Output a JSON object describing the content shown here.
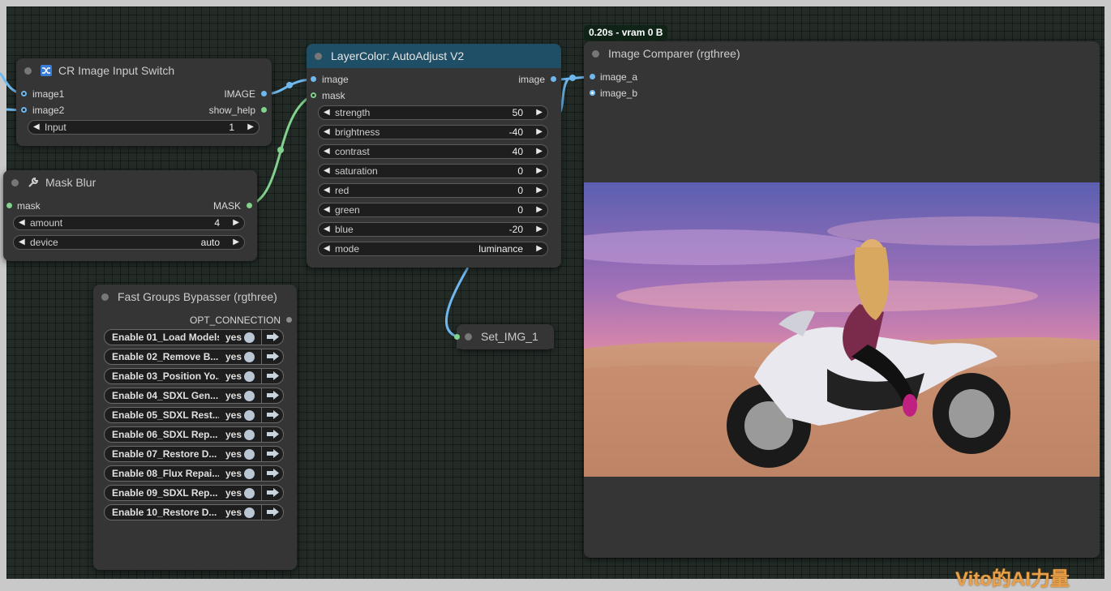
{
  "nodes": {
    "cr_switch": {
      "title": "CR Image Input Switch",
      "inputs": [
        "image1",
        "image2"
      ],
      "outputs": [
        "IMAGE",
        "show_help"
      ],
      "widgets": [
        {
          "label": "Input",
          "value": "1"
        }
      ]
    },
    "mask_blur": {
      "title": "Mask Blur",
      "input": "mask",
      "output": "MASK",
      "widgets": [
        {
          "label": "amount",
          "value": "4"
        },
        {
          "label": "device",
          "value": "auto"
        }
      ]
    },
    "autoadjust": {
      "title": "LayerColor: AutoAdjust V2",
      "inputs": [
        "image",
        "mask"
      ],
      "output": "image",
      "widgets": [
        {
          "label": "strength",
          "value": "50"
        },
        {
          "label": "brightness",
          "value": "-40"
        },
        {
          "label": "contrast",
          "value": "40"
        },
        {
          "label": "saturation",
          "value": "0"
        },
        {
          "label": "red",
          "value": "0"
        },
        {
          "label": "green",
          "value": "0"
        },
        {
          "label": "blue",
          "value": "-20"
        },
        {
          "label": "mode",
          "value": "luminance"
        }
      ]
    },
    "bypasser": {
      "title": "Fast Groups Bypasser (rgthree)",
      "output": "OPT_CONNECTION",
      "toggles": [
        {
          "label": "Enable 01_Load Models",
          "value": "yes"
        },
        {
          "label": "Enable 02_Remove B...",
          "value": "yes"
        },
        {
          "label": "Enable 03_Position Yo...",
          "value": "yes"
        },
        {
          "label": "Enable 04_SDXL Gen...",
          "value": "yes"
        },
        {
          "label": "Enable 05_SDXL Rest...",
          "value": "yes"
        },
        {
          "label": "Enable 06_SDXL Rep...",
          "value": "yes"
        },
        {
          "label": "Enable 07_Restore D...",
          "value": "yes"
        },
        {
          "label": "Enable 08_Flux Repai...",
          "value": "yes"
        },
        {
          "label": "Enable 09_SDXL Rep...",
          "value": "yes"
        },
        {
          "label": "Enable 10_Restore D...",
          "value": "yes"
        }
      ]
    },
    "set_img": {
      "title": "Set_IMG_1"
    },
    "comparer": {
      "title": "Image Comparer (rgthree)",
      "inputs": [
        "image_a",
        "image_b"
      ],
      "badge": "0.20s - vram 0 B"
    }
  },
  "watermark": "Vito的AI力量",
  "colors": {
    "image_wire": "#6fb8ef",
    "mask_wire": "#82d18c",
    "title_selected": "#1f4f66"
  },
  "icons": {
    "switch": "shuffle-icon",
    "mask_blur": "wrench-icon",
    "toggle_go": "arrow-right-icon"
  }
}
